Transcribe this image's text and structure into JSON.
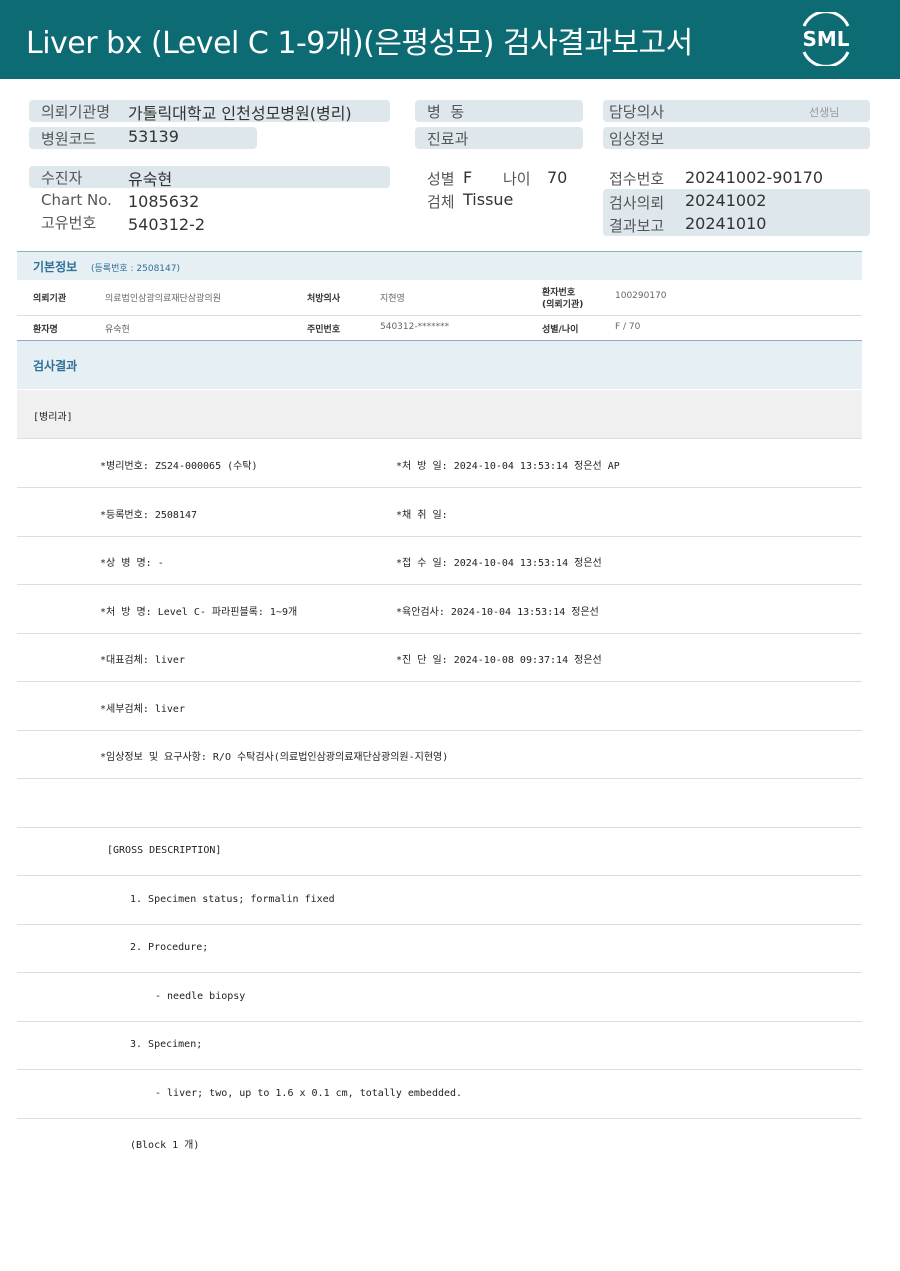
{
  "header": {
    "title": "Liver bx (Level C 1-9개)(은평성모) 검사결과보고서",
    "logo_text": "SML"
  },
  "patient": {
    "inst_label": "의뢰기관명",
    "inst_value": "가톨릭대학교 인천성모병원(병리)",
    "code_label": "병원코드",
    "code_value": "53139",
    "ward_label": "병  동",
    "dept_label": "진료과",
    "doctor_label": "담당의사",
    "doctor_suffix": "선생님",
    "clinic_label": "임상정보",
    "name_label": "수진자",
    "name_value": "유숙현",
    "chart_label": "Chart No.",
    "chart_value": "1085632",
    "uid_label": "고유번호",
    "uid_value": "540312-2",
    "sex_label": "성별",
    "sex_value": "F",
    "age_label": "나이",
    "age_value": "70",
    "specimen_label": "검체",
    "specimen_value": "Tissue",
    "receipt_label": "접수번호",
    "receipt_value": "20241002-90170",
    "request_label": "검사의뢰",
    "request_value": "20241002",
    "report_label": "결과보고",
    "report_value": "20241010"
  },
  "basic": {
    "title": "기본정보",
    "reg_note": "(등록번호 : 2508147)",
    "rows": [
      {
        "k1": "의뢰기관",
        "v1": "의료법인삼광의료재단삼광의원",
        "k2": "처방의사",
        "v2": "지현영",
        "k3a": "환자번호",
        "k3b": "(의뢰기관)",
        "v3": "100290170"
      },
      {
        "k1": "환자명",
        "v1": "유숙현",
        "k2": "주민번호",
        "v2": "540312-*******",
        "k3a": "성별/나이",
        "k3b": "",
        "v3": "F / 70"
      }
    ]
  },
  "results": {
    "title": "검사결과",
    "dept": "[병리과]",
    "rows": [
      {
        "left": "*병리번호: ZS24-000065 (수탁)",
        "right": "*처 방 일: 2024-10-04 13:53:14  정은선 AP"
      },
      {
        "left": "*등록번호: 2508147",
        "right": "*채 취 일:"
      },
      {
        "left": "*상 병 명: -",
        "right": "*접 수 일: 2024-10-04 13:53:14  정은선"
      },
      {
        "left": "*처 방 명: Level C- 파라핀블록: 1~9개",
        "right": "*육안검사: 2024-10-04 13:53:14  정은선"
      },
      {
        "left": "*대표검체: liver",
        "right": "*진 단 일: 2024-10-08 09:37:14  정은선"
      },
      {
        "left": "*세부검체: liver",
        "right": ""
      },
      {
        "left": "*임상정보 및 요구사항: R/O 수탁검사(의료법인삼광의료재단삼광의원-지현영)",
        "right": ""
      }
    ],
    "gross": [
      {
        "indent": 0,
        "text": ""
      },
      {
        "indent": 1,
        "text": "[GROSS DESCRIPTION]"
      },
      {
        "indent": 2,
        "text": "1. Specimen status; formalin fixed"
      },
      {
        "indent": 2,
        "text": "2. Procedure;"
      },
      {
        "indent": 3,
        "text": "- needle biopsy"
      },
      {
        "indent": 2,
        "text": "3. Specimen;"
      },
      {
        "indent": 3,
        "text": "- liver; two, up to 1.6 x 0.1 cm, totally embedded."
      },
      {
        "indent": 2,
        "text": "(Block 1 개)"
      }
    ]
  },
  "colors": {
    "header_bg": "#0d6b73",
    "pill_bg": "#dde7ec",
    "section_bg": "#e6eff4",
    "accent": "#2f6f98"
  }
}
